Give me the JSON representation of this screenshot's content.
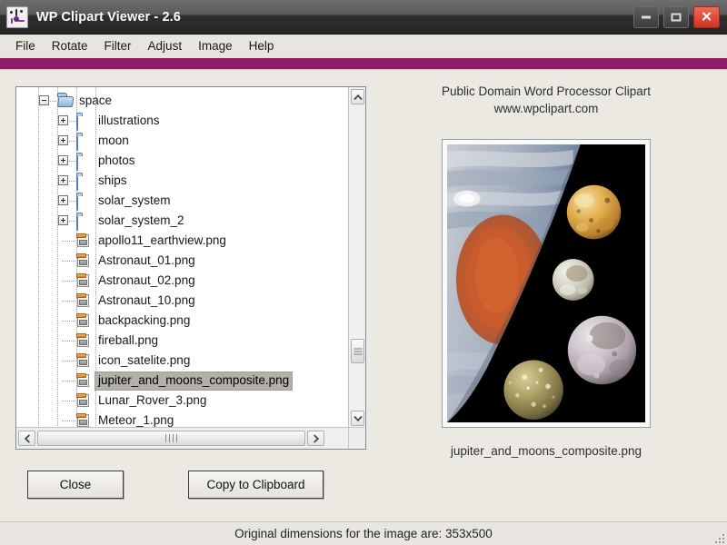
{
  "window": {
    "title": "WP Clipart Viewer - 2.6",
    "icon": "clipart-app-icon",
    "minimize_label": "–",
    "maximize_label": "□",
    "close_label": "✕",
    "accent_color": "#8e1b63"
  },
  "menu": {
    "items": [
      {
        "label": "File"
      },
      {
        "label": "Rotate"
      },
      {
        "label": "Filter"
      },
      {
        "label": "Adjust"
      },
      {
        "label": "Image"
      },
      {
        "label": "Help"
      }
    ]
  },
  "tree": {
    "nodes": [
      {
        "label": "space",
        "type": "folder-open",
        "toggle": "minus",
        "depth": 2,
        "selected": false
      },
      {
        "label": "illustrations",
        "type": "folder-closed",
        "toggle": "plus",
        "depth": 3,
        "selected": false
      },
      {
        "label": "moon",
        "type": "folder-closed",
        "toggle": "plus",
        "depth": 3,
        "selected": false
      },
      {
        "label": "photos",
        "type": "folder-closed",
        "toggle": "plus",
        "depth": 3,
        "selected": false
      },
      {
        "label": "ships",
        "type": "folder-closed",
        "toggle": "plus",
        "depth": 3,
        "selected": false
      },
      {
        "label": "solar_system",
        "type": "folder-closed",
        "toggle": "plus",
        "depth": 3,
        "selected": false
      },
      {
        "label": "solar_system_2",
        "type": "folder-closed",
        "toggle": "plus",
        "depth": 3,
        "selected": false
      },
      {
        "label": "apollo11_earthview.png",
        "type": "file",
        "toggle": "none",
        "depth": 3,
        "selected": false
      },
      {
        "label": "Astronaut_01.png",
        "type": "file",
        "toggle": "none",
        "depth": 3,
        "selected": false
      },
      {
        "label": "Astronaut_02.png",
        "type": "file",
        "toggle": "none",
        "depth": 3,
        "selected": false
      },
      {
        "label": "Astronaut_10.png",
        "type": "file",
        "toggle": "none",
        "depth": 3,
        "selected": false
      },
      {
        "label": "backpacking.png",
        "type": "file",
        "toggle": "none",
        "depth": 3,
        "selected": false
      },
      {
        "label": "fireball.png",
        "type": "file",
        "toggle": "none",
        "depth": 3,
        "selected": false
      },
      {
        "label": "icon_satelite.png",
        "type": "file",
        "toggle": "none",
        "depth": 3,
        "selected": false
      },
      {
        "label": "jupiter_and_moons_composite.png",
        "type": "file",
        "toggle": "none",
        "depth": 3,
        "selected": true
      },
      {
        "label": "Lunar_Rover_3.png",
        "type": "file",
        "toggle": "none",
        "depth": 3,
        "selected": false
      },
      {
        "label": "Meteor_1.png",
        "type": "file",
        "toggle": "none",
        "depth": 3,
        "selected": false
      }
    ],
    "scroll_up_icon": "chevron-up-icon",
    "scroll_down_icon": "chevron-down-icon",
    "scroll_left_icon": "chevron-left-icon",
    "scroll_right_icon": "chevron-right-icon"
  },
  "preview": {
    "credit_line1": "Public Domain Word Processor Clipart",
    "credit_line2": "www.wpclipart.com",
    "caption": "jupiter_and_moons_composite.png",
    "image_alt": "jupiter-and-moons-composite-image"
  },
  "buttons": {
    "close": "Close",
    "copy_to_clipboard": "Copy to Clipboard"
  },
  "status": {
    "text": "Original  dimensions for the image are:   353x500"
  }
}
